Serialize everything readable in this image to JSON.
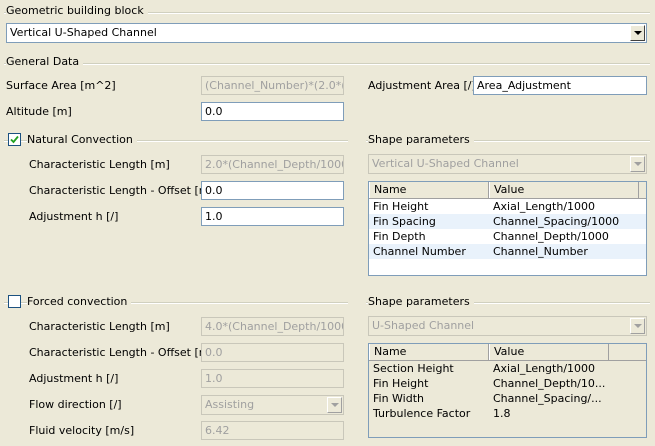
{
  "building_block": {
    "title": "Geometric building block",
    "selected": "Vertical U-Shaped Channel"
  },
  "general_data": {
    "title": "General Data",
    "surface_area_label": "Surface Area [m^2]",
    "surface_area_value": "(Channel_Number)*(2.0*(C",
    "adjustment_area_label": "Adjustment Area [/]",
    "adjustment_area_value": "Area_Adjustment",
    "altitude_label": "Altitude [m]",
    "altitude_value": "0.0"
  },
  "natural_convection": {
    "title": "Natural Convection",
    "checked": true,
    "char_length_label": "Characteristic Length [m]",
    "char_length_value": "2.0*(Channel_Depth/1000",
    "char_offset_label": "Characteristic Length - Offset [m]",
    "char_offset_value": "0.0",
    "adjustment_h_label": "Adjustment h [/]",
    "adjustment_h_value": "1.0"
  },
  "shape_parameters_1": {
    "title": "Shape parameters",
    "selected": "Vertical U-Shaped Channel",
    "columns": [
      "Name",
      "Value"
    ],
    "rows": [
      [
        "Fin Height",
        "Axial_Length/1000"
      ],
      [
        "Fin Spacing",
        "Channel_Spacing/1000"
      ],
      [
        "Fin Depth",
        "Channel_Depth/1000"
      ],
      [
        "Channel Number",
        "Channel_Number"
      ]
    ]
  },
  "forced_convection": {
    "title": "Forced convection",
    "checked": false,
    "char_length_label": "Characteristic Length [m]",
    "char_length_value": "4.0*(Channel_Depth/1000",
    "char_offset_label": "Characteristic Length - Offset [m]",
    "char_offset_value": "0.0",
    "adjustment_h_label": "Adjustment h [/]",
    "adjustment_h_value": "1.0",
    "flow_direction_label": "Flow direction [/]",
    "flow_direction_value": "Assisting",
    "fluid_velocity_label": "Fluid velocity [m/s]",
    "fluid_velocity_value": "6.42"
  },
  "shape_parameters_2": {
    "title": "Shape parameters",
    "selected": "U-Shaped Channel",
    "columns": [
      "Name",
      "Value"
    ],
    "rows": [
      [
        "Section Height",
        "Axial_Length/1000"
      ],
      [
        "Fin Height",
        "Channel_Depth/10..."
      ],
      [
        "Fin Width",
        "Channel_Spacing/..."
      ],
      [
        "Turbulence Factor",
        "1.8"
      ]
    ]
  },
  "icons": {
    "dropdown": "chevron-down-icon",
    "check": "checkmark-icon"
  }
}
